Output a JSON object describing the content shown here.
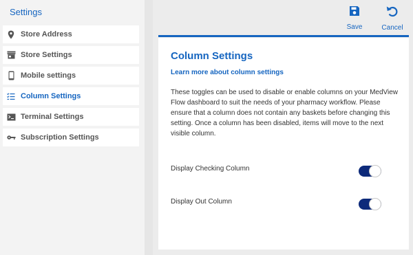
{
  "sidebar": {
    "title": "Settings",
    "items": [
      {
        "label": "Store Address",
        "icon": "location-pin-icon"
      },
      {
        "label": "Store Settings",
        "icon": "storefront-icon"
      },
      {
        "label": "Mobile settings",
        "icon": "mobile-phone-icon"
      },
      {
        "label": "Column Settings",
        "icon": "list-checklist-icon",
        "active": true
      },
      {
        "label": "Terminal Settings",
        "icon": "terminal-icon"
      },
      {
        "label": "Subscription Settings",
        "icon": "key-icon"
      }
    ]
  },
  "toolbar": {
    "save_label": "Save",
    "cancel_label": "Cancel"
  },
  "card": {
    "title": "Column Settings",
    "link": "Learn more about column settings",
    "description": "These toggles can be used to disable or enable columns on your MedView Flow dashboard to suit the needs of your pharmacy workflow. Please ensure that a column does not contain any baskets before changing this setting. Once a column has been disabled, items will move to the next visible column.",
    "toggles": [
      {
        "label": "Display Checking Column",
        "enabled": true
      },
      {
        "label": "Display Out Column",
        "enabled": true
      }
    ]
  },
  "colors": {
    "accent": "#1565c0",
    "toggle_on": "#0d2a7a",
    "sidebar_bg": "#f3f3f3",
    "main_bg": "#ececec"
  }
}
